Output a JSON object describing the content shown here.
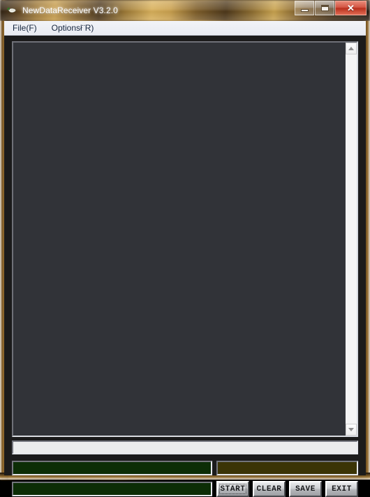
{
  "window": {
    "title": "NewDataReceiver V3.2.0",
    "icon": "app-bird-icon",
    "controls": {
      "minimize_label": "",
      "maximize_label": "",
      "close_label": "✕"
    }
  },
  "menubar": {
    "items": [
      {
        "label": "File(F)",
        "name": "menu-file"
      },
      {
        "label": "Optionsł¨R)",
        "name": "menu-options"
      }
    ]
  },
  "log": {
    "content": "",
    "placeholder": ""
  },
  "scrollbar": {
    "up_arrow": "scroll-up-icon",
    "down_arrow": "scroll-down-icon",
    "position_percent": 0
  },
  "fields": {
    "status": {
      "value": "",
      "label": "status-field"
    },
    "green_left_top": {
      "value": "",
      "label": "counter-field-1"
    },
    "olive_right": {
      "value": "",
      "label": "counter-field-olive"
    },
    "green_left_bottom": {
      "value": "",
      "label": "counter-field-2"
    }
  },
  "buttons": {
    "start": "START",
    "clear": "CLEAR",
    "save": "SAVE",
    "exit": "EXIT"
  },
  "colors": {
    "log_background": "#313338",
    "green_field": "#0c2d06",
    "olive_field": "#3b3406",
    "status_field": "#eceded",
    "close_button": "#b8301d",
    "menubar": "#eef0f5"
  }
}
